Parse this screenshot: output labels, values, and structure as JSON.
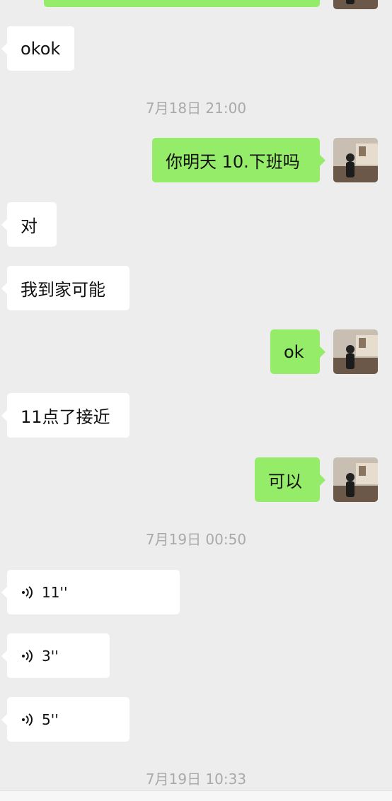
{
  "messages": {
    "m1": "okok",
    "m2": "你明天 10.下班吗",
    "m3": "对",
    "m4": "我到家可能",
    "m5": "ok",
    "m6": "11点了接近",
    "m7": "可以"
  },
  "timestamps": {
    "t1": "7月18日 21:00",
    "t2": "7月19日 00:50",
    "t3": "7月19日 10:33"
  },
  "voice": {
    "v1": "11''",
    "v2": "3''",
    "v3": "5''"
  },
  "colors": {
    "background": "#ededed",
    "incoming": "#ffffff",
    "outgoing": "#95ec69",
    "timestamp": "#a9a9a9"
  },
  "icons": {
    "voice": "voice-wave-icon",
    "avatar": "user-avatar-photo"
  }
}
